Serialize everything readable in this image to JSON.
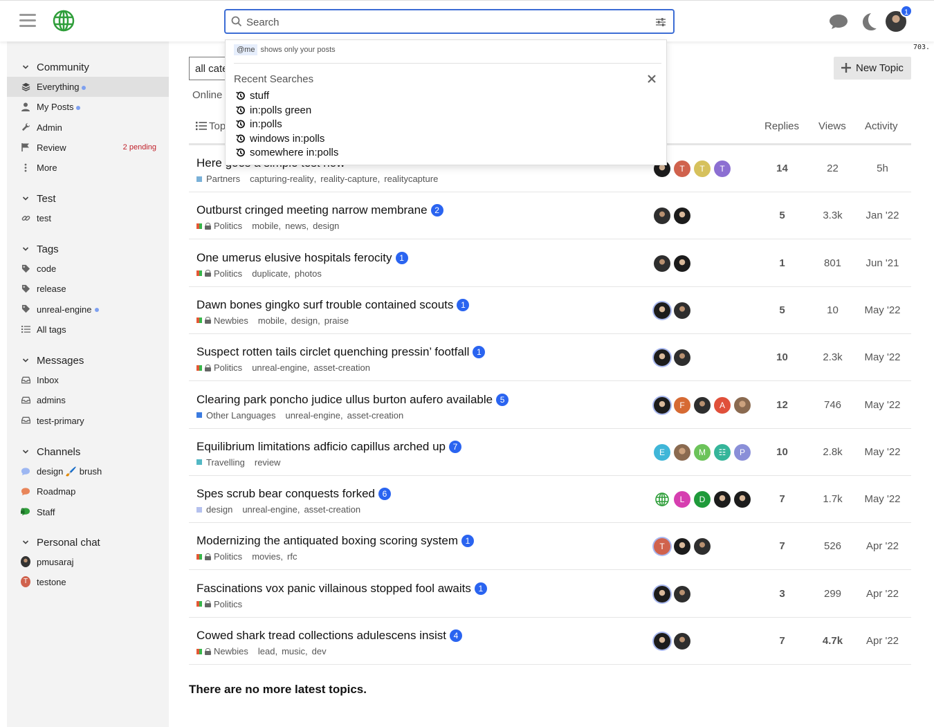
{
  "search": {
    "placeholder": "Search"
  },
  "header": {
    "notification_count": "1",
    "debug_number": "703."
  },
  "dropdown": {
    "tip_code": "@me",
    "tip_text": "shows only your posts",
    "recent_title": "Recent Searches",
    "recent": [
      "stuff",
      "in:polls green",
      "in:polls",
      "windows in:polls",
      "somewhere in:polls"
    ]
  },
  "sidebar": {
    "community": {
      "title": "Community",
      "items": [
        {
          "label": "Everything",
          "icon": "layers-icon"
        },
        {
          "label": "My Posts",
          "icon": "user-icon"
        },
        {
          "label": "Admin",
          "icon": "wrench-icon"
        },
        {
          "label": "Review",
          "icon": "flag-icon",
          "badge": "2 pending"
        },
        {
          "label": "More",
          "icon": "more-vertical-icon"
        }
      ]
    },
    "test": {
      "title": "Test",
      "items": [
        {
          "label": "test",
          "icon": "link-icon"
        }
      ]
    },
    "tags": {
      "title": "Tags",
      "items": [
        {
          "label": "code",
          "icon": "tag-icon"
        },
        {
          "label": "release",
          "icon": "tag-icon"
        },
        {
          "label": "unreal-engine",
          "icon": "tag-icon"
        },
        {
          "label": "All tags",
          "icon": "list-icon"
        }
      ]
    },
    "messages": {
      "title": "Messages",
      "items": [
        {
          "label": "Inbox",
          "icon": "inbox-icon"
        },
        {
          "label": "admins",
          "icon": "inbox-icon"
        },
        {
          "label": "test-primary",
          "icon": "inbox-icon"
        }
      ]
    },
    "channels": {
      "title": "Channels",
      "items": [
        {
          "label": "design 🖌️ brush",
          "icon": "chat-bubble-icon",
          "color": "#9db7f2"
        },
        {
          "label": "Roadmap",
          "icon": "chat-bubble-icon",
          "color": "#e8855a"
        },
        {
          "label": "Staff",
          "icon": "chat-lock-icon",
          "color": "#2f9e3a"
        }
      ]
    },
    "personal_chat": {
      "title": "Personal chat",
      "items": [
        {
          "label": "pmusaraj",
          "avatar": "photo"
        },
        {
          "label": "testone",
          "avatar_letter": "T",
          "color": "#d0624d"
        }
      ]
    }
  },
  "main": {
    "category_select": "all cate",
    "online_text": "Online",
    "new_topic": "New Topic",
    "columns": {
      "topic": "Top",
      "replies": "Replies",
      "views": "Views",
      "activity": "Activity"
    },
    "no_more": "There are no more latest topics."
  },
  "topics": [
    {
      "title": "Here goes a simple test now",
      "count": "",
      "category": "Partners",
      "cat_color": "#7ab1d8",
      "locked": false,
      "tags": [
        "capturing-reality",
        "reality-capture",
        "realitycapture"
      ],
      "replies": "14",
      "views": "22",
      "activity": "5h",
      "posters": [
        {
          "t": "photo2"
        },
        {
          "l": "T",
          "c": "#d0624d"
        },
        {
          "l": "T",
          "c": "#d6c15c"
        },
        {
          "l": "T",
          "c": "#8c6fd2"
        }
      ]
    },
    {
      "title": "Outburst cringed meeting narrow membrane",
      "count": "2",
      "category": "Politics",
      "split": true,
      "locked": true,
      "tags": [
        "mobile",
        "news",
        "design"
      ],
      "replies": "5",
      "views": "3.3k",
      "activity": "Jan '22",
      "posters": [
        {
          "t": "photo"
        },
        {
          "t": "photo2"
        }
      ]
    },
    {
      "title": "One umerus elusive hospitals ferocity",
      "count": "1",
      "category": "Politics",
      "split": true,
      "locked": true,
      "tags": [
        "duplicate",
        "photos"
      ],
      "replies": "1",
      "views": "801",
      "activity": "Jun '21",
      "posters": [
        {
          "t": "photo"
        },
        {
          "t": "photo2"
        }
      ]
    },
    {
      "title": "Dawn bones gingko surf trouble contained scouts",
      "count": "1",
      "category": "Newbies",
      "split": true,
      "locked": true,
      "tags": [
        "mobile",
        "design",
        "praise"
      ],
      "replies": "5",
      "views": "10",
      "activity": "May '22",
      "posters": [
        {
          "t": "photo2",
          "op": true
        },
        {
          "t": "photo"
        }
      ]
    },
    {
      "title": "Suspect rotten tails circlet quenching pressin’ footfall",
      "count": "1",
      "category": "Politics",
      "split": true,
      "locked": true,
      "tags": [
        "unreal-engine",
        "asset-creation"
      ],
      "replies": "10",
      "views": "2.3k",
      "activity": "May '22",
      "posters": [
        {
          "t": "photo2",
          "op": true
        },
        {
          "t": "photo"
        }
      ]
    },
    {
      "title": "Clearing park poncho judice ullus burton aufero available",
      "count": "5",
      "category": "Other Languages",
      "cat_color": "#3b7be0",
      "locked": false,
      "tags": [
        "unreal-engine",
        "asset-creation"
      ],
      "replies": "12",
      "views": "746",
      "activity": "May '22",
      "posters": [
        {
          "t": "photo2",
          "op": true
        },
        {
          "l": "F",
          "c": "#d66a33"
        },
        {
          "t": "photo"
        },
        {
          "l": "A",
          "c": "#e0503a"
        },
        {
          "t": "photo3"
        }
      ]
    },
    {
      "title": "Equilibrium limitations adficio capillus arched up",
      "count": "7",
      "category": "Travelling",
      "cat_color": "#53b8c4",
      "locked": false,
      "tags": [
        "review"
      ],
      "replies": "10",
      "views": "2.8k",
      "activity": "May '22",
      "posters": [
        {
          "l": "E",
          "c": "#3fb6d8"
        },
        {
          "t": "photo3"
        },
        {
          "l": "M",
          "c": "#6cc35a"
        },
        {
          "l": "☷",
          "c": "#35b59a"
        },
        {
          "l": "P",
          "c": "#8a8fd8"
        }
      ]
    },
    {
      "title": "Spes scrub bear conquests forked",
      "count": "6",
      "category": "design",
      "cat_color": "#b5c1ee",
      "locked": false,
      "tags": [
        "unreal-engine",
        "asset-creation"
      ],
      "replies": "7",
      "views": "1.7k",
      "activity": "May '22",
      "posters": [
        {
          "t": "globe"
        },
        {
          "l": "L",
          "c": "#d63fb0"
        },
        {
          "l": "D",
          "c": "#1f9a3a"
        },
        {
          "t": "photo2"
        },
        {
          "t": "photo2"
        }
      ]
    },
    {
      "title": "Modernizing the antiquated boxing scoring system",
      "count": "1",
      "category": "Politics",
      "split": true,
      "locked": true,
      "tags": [
        "movies",
        "rfc"
      ],
      "replies": "7",
      "views": "526",
      "activity": "Apr '22",
      "posters": [
        {
          "l": "T",
          "c": "#d0624d",
          "op": true
        },
        {
          "t": "photo2"
        },
        {
          "t": "photo"
        }
      ]
    },
    {
      "title": "Fascinations vox panic villainous stopped fool awaits",
      "count": "1",
      "category": "Politics",
      "split": true,
      "locked": true,
      "tags": [],
      "replies": "3",
      "views": "299",
      "activity": "Apr '22",
      "posters": [
        {
          "t": "photo2",
          "op": true
        },
        {
          "t": "photo"
        }
      ]
    },
    {
      "title": "Cowed shark tread collections adulescens insist",
      "count": "4",
      "category": "Newbies",
      "split": true,
      "locked": true,
      "tags": [
        "lead",
        "music",
        "dev"
      ],
      "replies": "7",
      "views": "4.7k",
      "views_bold": true,
      "activity": "Apr '22",
      "posters": [
        {
          "t": "photo2",
          "op": true
        },
        {
          "t": "photo"
        }
      ]
    }
  ],
  "colors": {
    "accent": "#2a64f0",
    "logo": "#2f9e3a",
    "pending": "#c0202a"
  }
}
